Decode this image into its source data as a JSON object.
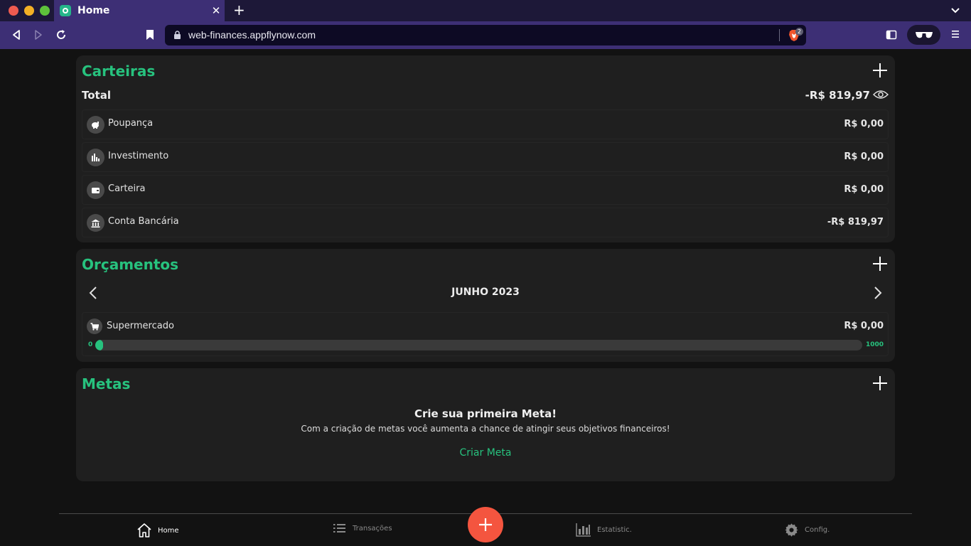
{
  "browser": {
    "tab_title": "Home",
    "tab_close": "✕",
    "new_tab": "+",
    "url": "web-finances.appflynow.com",
    "shields_count": "2"
  },
  "wallets": {
    "title": "Carteiras",
    "total_label": "Total",
    "total_value": "-R$ 819,97",
    "items": [
      {
        "icon": "piggy-bank-icon",
        "label": "Poupança",
        "value": "R$ 0,00"
      },
      {
        "icon": "bar-chart-icon",
        "label": "Investimento",
        "value": "R$ 0,00"
      },
      {
        "icon": "wallet-icon",
        "label": "Carteira",
        "value": "R$ 0,00"
      },
      {
        "icon": "bank-icon",
        "label": "Conta Bancária",
        "value": "-R$ 819,97"
      }
    ]
  },
  "budgets": {
    "title": "Orçamentos",
    "month": "JUNHO 2023",
    "item": {
      "icon": "cart-icon",
      "label": "Supermercado",
      "value": "R$ 0,00",
      "min": "0",
      "max": "1000",
      "progress_fraction": 0.0
    }
  },
  "goals": {
    "title": "Metas",
    "empty_title": "Crie sua primeira Meta!",
    "empty_desc": "Com a criação de metas você aumenta a chance de atingir seus objetivos financeiros!",
    "cta": "Criar Meta"
  },
  "bottom_nav": {
    "home": "Home",
    "transactions": "Transações",
    "statistics": "Estatistic.",
    "settings": "Config."
  },
  "colors": {
    "accent": "#27c27e",
    "fab": "#f4553f",
    "card_bg": "#1f1f1f",
    "page_bg": "#121212",
    "browser_purple": "#3d2f75"
  }
}
